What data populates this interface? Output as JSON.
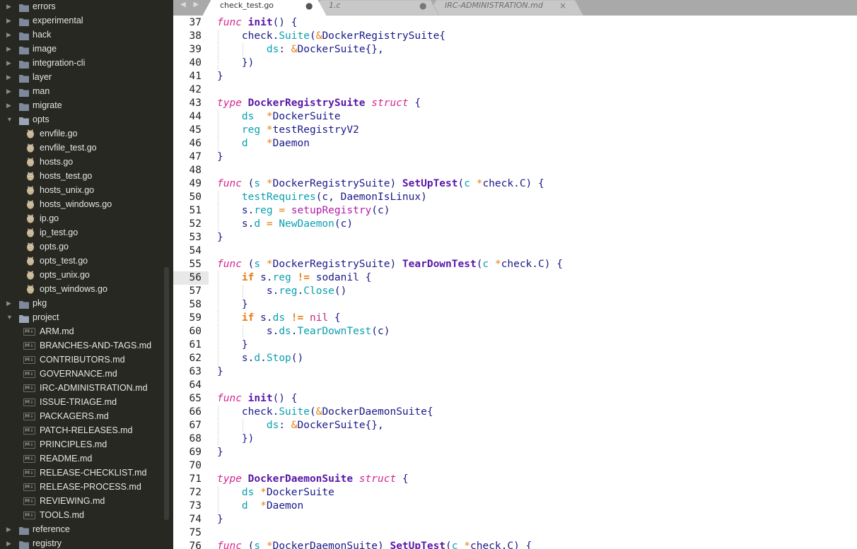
{
  "colors": {
    "sidebar_bg": "#272822",
    "tabbar_bg": "#a9a9a9",
    "editor_bg": "#ffffff",
    "keyword": "#d72491",
    "function_name": "#5a17a8",
    "type_name": "#1a1a8a",
    "ampersand": "#e67e10",
    "field": "#0aa0b0"
  },
  "sidebar": {
    "items": [
      {
        "label": "errors",
        "kind": "folder",
        "expanded": false
      },
      {
        "label": "experimental",
        "kind": "folder",
        "expanded": false
      },
      {
        "label": "hack",
        "kind": "folder",
        "expanded": false
      },
      {
        "label": "image",
        "kind": "folder",
        "expanded": false
      },
      {
        "label": "integration-cli",
        "kind": "folder",
        "expanded": false
      },
      {
        "label": "layer",
        "kind": "folder",
        "expanded": false
      },
      {
        "label": "man",
        "kind": "folder",
        "expanded": false
      },
      {
        "label": "migrate",
        "kind": "folder",
        "expanded": false
      },
      {
        "label": "opts",
        "kind": "folder",
        "expanded": true
      },
      {
        "label": "envfile.go",
        "kind": "go"
      },
      {
        "label": "envfile_test.go",
        "kind": "go"
      },
      {
        "label": "hosts.go",
        "kind": "go"
      },
      {
        "label": "hosts_test.go",
        "kind": "go"
      },
      {
        "label": "hosts_unix.go",
        "kind": "go"
      },
      {
        "label": "hosts_windows.go",
        "kind": "go"
      },
      {
        "label": "ip.go",
        "kind": "go"
      },
      {
        "label": "ip_test.go",
        "kind": "go"
      },
      {
        "label": "opts.go",
        "kind": "go"
      },
      {
        "label": "opts_test.go",
        "kind": "go"
      },
      {
        "label": "opts_unix.go",
        "kind": "go"
      },
      {
        "label": "opts_windows.go",
        "kind": "go"
      },
      {
        "label": "pkg",
        "kind": "folder",
        "expanded": false
      },
      {
        "label": "project",
        "kind": "folder",
        "expanded": true
      },
      {
        "label": "ARM.md",
        "kind": "md"
      },
      {
        "label": "BRANCHES-AND-TAGS.md",
        "kind": "md"
      },
      {
        "label": "CONTRIBUTORS.md",
        "kind": "md"
      },
      {
        "label": "GOVERNANCE.md",
        "kind": "md"
      },
      {
        "label": "IRC-ADMINISTRATION.md",
        "kind": "md"
      },
      {
        "label": "ISSUE-TRIAGE.md",
        "kind": "md"
      },
      {
        "label": "PACKAGERS.md",
        "kind": "md"
      },
      {
        "label": "PATCH-RELEASES.md",
        "kind": "md"
      },
      {
        "label": "PRINCIPLES.md",
        "kind": "md"
      },
      {
        "label": "README.md",
        "kind": "md"
      },
      {
        "label": "RELEASE-CHECKLIST.md",
        "kind": "md"
      },
      {
        "label": "RELEASE-PROCESS.md",
        "kind": "md"
      },
      {
        "label": "REVIEWING.md",
        "kind": "md"
      },
      {
        "label": "TOOLS.md",
        "kind": "md"
      },
      {
        "label": "reference",
        "kind": "folder",
        "expanded": false
      },
      {
        "label": "registry",
        "kind": "folder",
        "expanded": false
      }
    ],
    "md_badge": "M↓"
  },
  "tabs": [
    {
      "label": "check_test.go",
      "active": true,
      "status": "●"
    },
    {
      "label": "1.c",
      "active": false,
      "status": "●"
    },
    {
      "label": "IRC-ADMINISTRATION.md",
      "active": false,
      "status": "×"
    }
  ],
  "nav_arrows": "◀ ▶",
  "editor": {
    "current_line": 56,
    "lines": [
      {
        "n": "37",
        "tokens": [
          [
            "kw",
            "func"
          ],
          [
            "p",
            " "
          ],
          [
            "fn",
            "init"
          ],
          [
            "d",
            "() {"
          ]
        ]
      },
      {
        "n": "38",
        "tokens": [
          [
            "p",
            "    "
          ],
          [
            "d",
            "check."
          ],
          [
            "f",
            "Suite"
          ],
          [
            "d",
            "("
          ],
          [
            "a",
            "&"
          ],
          [
            "d",
            "DockerRegistrySuite{"
          ]
        ]
      },
      {
        "n": "39",
        "tokens": [
          [
            "p",
            "        "
          ],
          [
            "f",
            "ds"
          ],
          [
            "d",
            ": "
          ],
          [
            "a",
            "&"
          ],
          [
            "d",
            "DockerSuite{},"
          ]
        ]
      },
      {
        "n": "40",
        "tokens": [
          [
            "p",
            "    "
          ],
          [
            "d",
            "})"
          ]
        ]
      },
      {
        "n": "41",
        "tokens": [
          [
            "d",
            "}"
          ]
        ]
      },
      {
        "n": "42",
        "tokens": []
      },
      {
        "n": "43",
        "tokens": [
          [
            "kw",
            "type"
          ],
          [
            "p",
            " "
          ],
          [
            "fn",
            "DockerRegistrySuite"
          ],
          [
            "p",
            " "
          ],
          [
            "kw",
            "struct"
          ],
          [
            "d",
            " {"
          ]
        ]
      },
      {
        "n": "44",
        "tokens": [
          [
            "p",
            "    "
          ],
          [
            "f",
            "ds"
          ],
          [
            "p",
            "  "
          ],
          [
            "a",
            "*"
          ],
          [
            "d",
            "DockerSuite"
          ]
        ]
      },
      {
        "n": "45",
        "tokens": [
          [
            "p",
            "    "
          ],
          [
            "f",
            "reg"
          ],
          [
            "p",
            " "
          ],
          [
            "a",
            "*"
          ],
          [
            "d",
            "testRegistryV2"
          ]
        ]
      },
      {
        "n": "46",
        "tokens": [
          [
            "p",
            "    "
          ],
          [
            "f",
            "d"
          ],
          [
            "p",
            "   "
          ],
          [
            "a",
            "*"
          ],
          [
            "d",
            "Daemon"
          ]
        ]
      },
      {
        "n": "47",
        "tokens": [
          [
            "d",
            "}"
          ]
        ]
      },
      {
        "n": "48",
        "tokens": []
      },
      {
        "n": "49",
        "tokens": [
          [
            "kw",
            "func"
          ],
          [
            "d",
            " ("
          ],
          [
            "f",
            "s"
          ],
          [
            "p",
            " "
          ],
          [
            "a",
            "*"
          ],
          [
            "d",
            "DockerRegistrySuite) "
          ],
          [
            "fn",
            "SetUpTest"
          ],
          [
            "d",
            "("
          ],
          [
            "f",
            "c"
          ],
          [
            "p",
            " "
          ],
          [
            "a",
            "*"
          ],
          [
            "d",
            "check.C) {"
          ]
        ]
      },
      {
        "n": "50",
        "tokens": [
          [
            "p",
            "    "
          ],
          [
            "f",
            "testRequires"
          ],
          [
            "d",
            "(c, DaemonIsLinux)"
          ]
        ]
      },
      {
        "n": "51",
        "tokens": [
          [
            "p",
            "    "
          ],
          [
            "d",
            "s."
          ],
          [
            "f",
            "reg"
          ],
          [
            "p",
            " "
          ],
          [
            "a",
            "="
          ],
          [
            "p",
            " "
          ],
          [
            "m",
            "setupRegistry"
          ],
          [
            "d",
            "(c)"
          ]
        ]
      },
      {
        "n": "52",
        "tokens": [
          [
            "p",
            "    "
          ],
          [
            "d",
            "s."
          ],
          [
            "f",
            "d"
          ],
          [
            "p",
            " "
          ],
          [
            "a",
            "="
          ],
          [
            "p",
            " "
          ],
          [
            "f",
            "NewDaemon"
          ],
          [
            "d",
            "(c)"
          ]
        ]
      },
      {
        "n": "53",
        "tokens": [
          [
            "d",
            "}"
          ]
        ]
      },
      {
        "n": "54",
        "tokens": []
      },
      {
        "n": "55",
        "tokens": [
          [
            "kw",
            "func"
          ],
          [
            "d",
            " ("
          ],
          [
            "f",
            "s"
          ],
          [
            "p",
            " "
          ],
          [
            "a",
            "*"
          ],
          [
            "d",
            "DockerRegistrySuite) "
          ],
          [
            "fn",
            "TearDownTest"
          ],
          [
            "d",
            "("
          ],
          [
            "f",
            "c"
          ],
          [
            "p",
            " "
          ],
          [
            "a",
            "*"
          ],
          [
            "d",
            "check.C) {"
          ]
        ]
      },
      {
        "n": "56",
        "tokens": [
          [
            "p",
            "    "
          ],
          [
            "c",
            "if"
          ],
          [
            "p",
            " "
          ],
          [
            "d",
            "s."
          ],
          [
            "f",
            "reg"
          ],
          [
            "p",
            " "
          ],
          [
            "c",
            "!="
          ],
          [
            "d",
            " sodanil {"
          ]
        ]
      },
      {
        "n": "57",
        "tokens": [
          [
            "p",
            "        "
          ],
          [
            "d",
            "s."
          ],
          [
            "f",
            "reg"
          ],
          [
            "d",
            "."
          ],
          [
            "f",
            "Close"
          ],
          [
            "d",
            "()"
          ]
        ]
      },
      {
        "n": "58",
        "tokens": [
          [
            "p",
            "    "
          ],
          [
            "d",
            "}"
          ]
        ]
      },
      {
        "n": "59",
        "tokens": [
          [
            "p",
            "    "
          ],
          [
            "c",
            "if"
          ],
          [
            "p",
            " "
          ],
          [
            "d",
            "s."
          ],
          [
            "f",
            "ds"
          ],
          [
            "p",
            " "
          ],
          [
            "c",
            "!="
          ],
          [
            "p",
            " "
          ],
          [
            "n",
            "nil"
          ],
          [
            "d",
            " {"
          ]
        ]
      },
      {
        "n": "60",
        "tokens": [
          [
            "p",
            "        "
          ],
          [
            "d",
            "s."
          ],
          [
            "f",
            "ds"
          ],
          [
            "d",
            "."
          ],
          [
            "f",
            "TearDownTest"
          ],
          [
            "d",
            "(c)"
          ]
        ]
      },
      {
        "n": "61",
        "tokens": [
          [
            "p",
            "    "
          ],
          [
            "d",
            "}"
          ]
        ]
      },
      {
        "n": "62",
        "tokens": [
          [
            "p",
            "    "
          ],
          [
            "d",
            "s."
          ],
          [
            "f",
            "d"
          ],
          [
            "d",
            "."
          ],
          [
            "f",
            "Stop"
          ],
          [
            "d",
            "()"
          ]
        ]
      },
      {
        "n": "63",
        "tokens": [
          [
            "d",
            "}"
          ]
        ]
      },
      {
        "n": "64",
        "tokens": []
      },
      {
        "n": "65",
        "tokens": [
          [
            "kw",
            "func"
          ],
          [
            "p",
            " "
          ],
          [
            "fn",
            "init"
          ],
          [
            "d",
            "() {"
          ]
        ]
      },
      {
        "n": "66",
        "tokens": [
          [
            "p",
            "    "
          ],
          [
            "d",
            "check."
          ],
          [
            "f",
            "Suite"
          ],
          [
            "d",
            "("
          ],
          [
            "a",
            "&"
          ],
          [
            "d",
            "DockerDaemonSuite{"
          ]
        ]
      },
      {
        "n": "67",
        "tokens": [
          [
            "p",
            "        "
          ],
          [
            "f",
            "ds"
          ],
          [
            "d",
            ": "
          ],
          [
            "a",
            "&"
          ],
          [
            "d",
            "DockerSuite{},"
          ]
        ]
      },
      {
        "n": "68",
        "tokens": [
          [
            "p",
            "    "
          ],
          [
            "d",
            "})"
          ]
        ]
      },
      {
        "n": "69",
        "tokens": [
          [
            "d",
            "}"
          ]
        ]
      },
      {
        "n": "70",
        "tokens": []
      },
      {
        "n": "71",
        "tokens": [
          [
            "kw",
            "type"
          ],
          [
            "p",
            " "
          ],
          [
            "fn",
            "DockerDaemonSuite"
          ],
          [
            "p",
            " "
          ],
          [
            "kw",
            "struct"
          ],
          [
            "d",
            " {"
          ]
        ]
      },
      {
        "n": "72",
        "tokens": [
          [
            "p",
            "    "
          ],
          [
            "f",
            "ds"
          ],
          [
            "p",
            " "
          ],
          [
            "a",
            "*"
          ],
          [
            "d",
            "DockerSuite"
          ]
        ]
      },
      {
        "n": "73",
        "tokens": [
          [
            "p",
            "    "
          ],
          [
            "f",
            "d"
          ],
          [
            "p",
            "  "
          ],
          [
            "a",
            "*"
          ],
          [
            "d",
            "Daemon"
          ]
        ]
      },
      {
        "n": "74",
        "tokens": [
          [
            "d",
            "}"
          ]
        ]
      },
      {
        "n": "75",
        "tokens": []
      },
      {
        "n": "76",
        "tokens": [
          [
            "kw",
            "func"
          ],
          [
            "d",
            " ("
          ],
          [
            "f",
            "s"
          ],
          [
            "p",
            " "
          ],
          [
            "a",
            "*"
          ],
          [
            "d",
            "DockerDaemonSuite) "
          ],
          [
            "fn",
            "SetUpTest"
          ],
          [
            "d",
            "("
          ],
          [
            "f",
            "c"
          ],
          [
            "p",
            " "
          ],
          [
            "a",
            "*"
          ],
          [
            "d",
            "check.C) {"
          ]
        ]
      }
    ]
  }
}
